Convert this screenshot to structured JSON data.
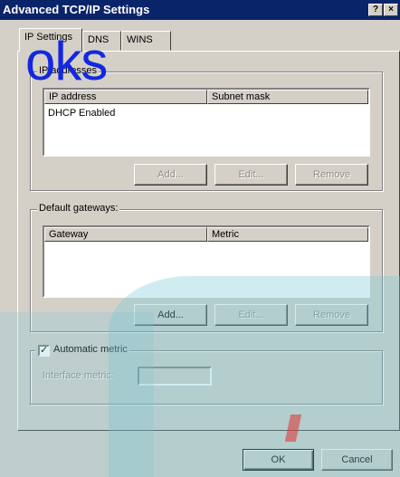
{
  "window": {
    "title": "Advanced TCP/IP Settings",
    "help_glyph": "?",
    "close_glyph": "×"
  },
  "tabs": [
    {
      "label": "IP Settings",
      "active": true
    },
    {
      "label": "DNS",
      "active": false
    },
    {
      "label": "WINS",
      "active": false
    }
  ],
  "ip_addresses": {
    "legend": "IP addresses",
    "columns": [
      "IP address",
      "Subnet mask"
    ],
    "rows": [
      "DHCP Enabled"
    ],
    "buttons": {
      "add": "Add...",
      "edit": "Edit...",
      "remove": "Remove"
    }
  },
  "default_gateways": {
    "legend": "Default gateways:",
    "columns": [
      "Gateway",
      "Metric"
    ],
    "rows": [],
    "buttons": {
      "add": "Add...",
      "edit": "Edit...",
      "remove": "Remove"
    }
  },
  "automatic_metric": {
    "label": "Automatic metric",
    "checked": true,
    "interface_metric_label": "Interface metric:",
    "interface_metric_value": ""
  },
  "footer": {
    "ok": "OK",
    "cancel": "Cancel"
  },
  "watermark": {
    "text": "oks"
  },
  "colors": {
    "titlebar": "#0a246a",
    "face": "#d4d0c8",
    "disabled_text": "#8e8c86",
    "watermark_blue": "#1228e0",
    "overlay_teal": "#78c8d7"
  }
}
